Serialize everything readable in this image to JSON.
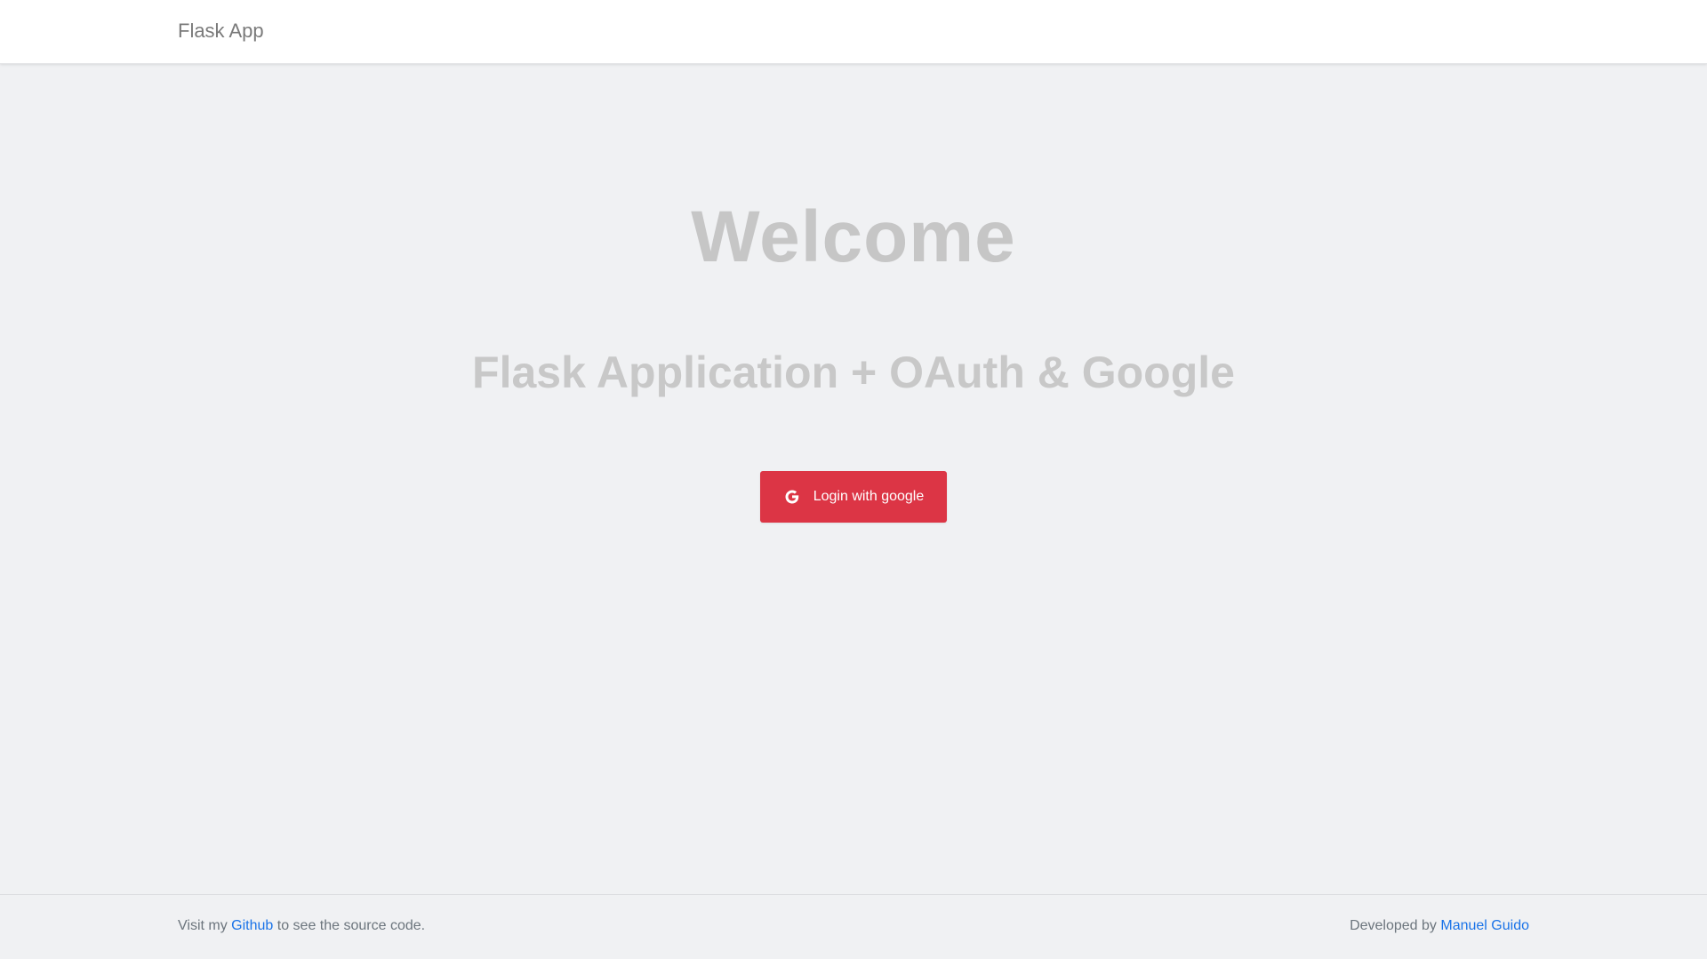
{
  "navbar": {
    "brand": "Flask App"
  },
  "hero": {
    "title": "Welcome",
    "subtitle": "Flask Application + OAuth & Google",
    "login_button": {
      "label": "Login with google",
      "icon": "google-icon",
      "color": "#dc3545"
    }
  },
  "footer": {
    "left_prefix": "Visit my",
    "left_link": "Github",
    "left_suffix": "to see the source code.",
    "right_prefix": "Developed by",
    "right_link": "Manuel Guido",
    "link_color": "#1a73e8"
  }
}
